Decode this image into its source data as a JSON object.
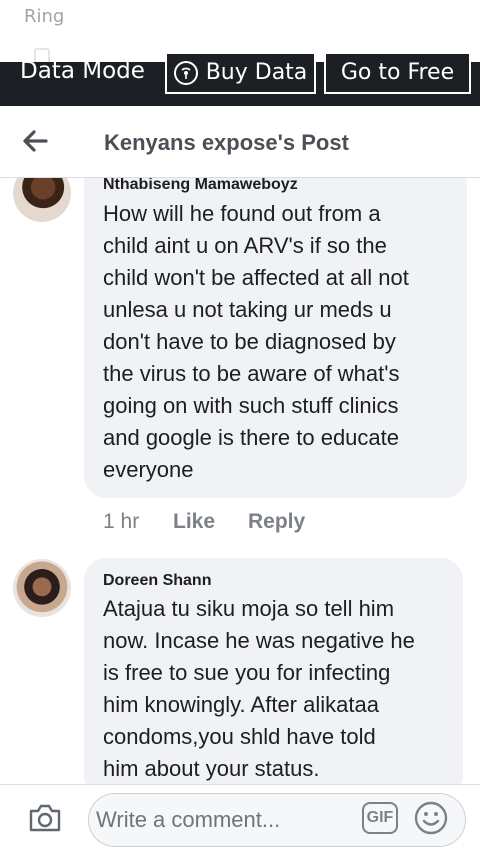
{
  "status_bar": {
    "text": "Ring"
  },
  "data_bar": {
    "mode_label": "Data Mode",
    "buy_data_label": "Buy Data",
    "go_free_label": "Go to Free"
  },
  "header": {
    "title": "Kenyans expose's Post"
  },
  "comments": [
    {
      "author": "Nthabiseng Mamaweboyz",
      "text": "How will he found out from a\nchild aint u on ARV's if so the\nchild won't be affected at all not\nunlesa u not taking ur meds u\ndon't have to be diagnosed by\nthe virus to be aware of what's\ngoing on with such stuff clinics\nand google is there to educate\neveryone",
      "time": "1 hr",
      "like_label": "Like",
      "reply_label": "Reply"
    },
    {
      "author": "Doreen Shann",
      "text": "Atajua tu siku moja so tell him\nnow. Incase he was negative he\nis free to sue you for infecting\nhim knowingly. After alikataa\ncondoms,you shld have told\nhim about your status."
    }
  ],
  "composer": {
    "placeholder": "Write a comment...",
    "gif_label": "GIF"
  },
  "icons": {
    "back": "back-arrow-icon",
    "camera": "camera-icon",
    "gif": "gif-icon",
    "emoji": "smiley-icon",
    "wifi": "wifi-icon"
  },
  "colors": {
    "data_bar_bg": "#1c1f24",
    "bubble_bg": "#f1f2f6",
    "title_text": "#4b4f56",
    "meta_text": "#7c8088"
  }
}
